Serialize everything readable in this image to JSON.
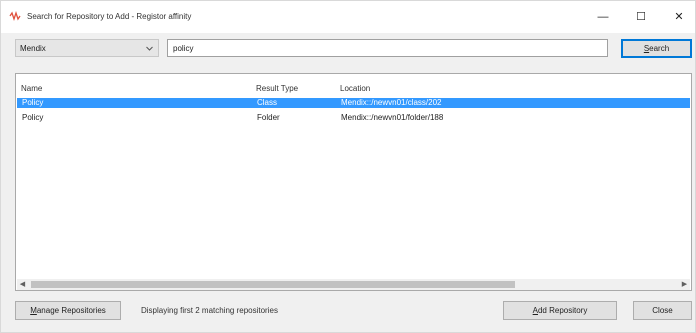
{
  "window": {
    "title": "Search for Repository to Add - Registor affinity",
    "controls": {
      "minimize": "—",
      "maximize": "☐",
      "close": "✕"
    }
  },
  "search": {
    "repository": "Mendix",
    "query": "policy",
    "button_label": "Search",
    "button_mnemonic": "S",
    "button_rest": "earch"
  },
  "results": {
    "columns": [
      "Name",
      "Result Type",
      "Location"
    ],
    "rows": [
      {
        "name": "Policy",
        "type": "Class",
        "location": "Mendix::/newvn01/class/202",
        "selected": true
      },
      {
        "name": "Policy",
        "type": "Folder",
        "location": "Mendix::/newvn01/folder/188",
        "selected": false
      }
    ]
  },
  "footer": {
    "manage_label": "Manage Repositories",
    "manage_mnemonic": "M",
    "manage_rest": "anage Repositories",
    "status": "Displaying first 2 matching repositories",
    "add_label": "Add Repository",
    "add_mnemonic": "A",
    "add_rest": "dd Repository",
    "close_label": "Close"
  },
  "colors": {
    "selection": "#3399ff",
    "focus_border": "#0078d7",
    "app_icon": "#e0503c"
  },
  "icons": {
    "app": "app-logo-icon",
    "dropdown": "chevron-down-icon",
    "scroll_left": "scroll-left-icon",
    "scroll_right": "scroll-right-icon"
  }
}
